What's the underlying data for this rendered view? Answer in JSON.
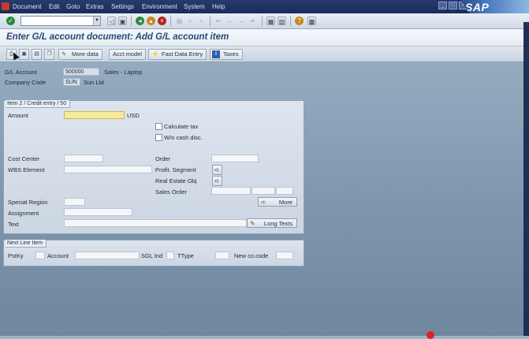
{
  "menu": [
    "Document",
    "Edit",
    "Goto",
    "Extras",
    "Settings",
    "Environment",
    "System",
    "Help"
  ],
  "brand": "SAP",
  "title": "Enter G/L account document: Add G/L account item",
  "app_toolbar": {
    "more_data": "More data",
    "acct_model": "Acct model",
    "fast_data_entry": "Fast Data Entry",
    "taxes": "Taxes"
  },
  "header": {
    "gl_account_label": "G/L Account",
    "gl_account_value": "500000",
    "gl_account_desc": "Sales - Laptop",
    "company_code_label": "Company Code",
    "company_code_value": "SUN",
    "company_code_desc": "Sun Ltd"
  },
  "item_group": {
    "title": "Item 2 / Credit entry / 50",
    "amount_label": "Amount",
    "amount_value": "",
    "currency": "USD",
    "calculate_tax": "Calculate tax",
    "wo_cash_disc": "W/o cash disc.",
    "cost_center": "Cost Center",
    "order": "Order",
    "wbs_element": "WBS Element",
    "profit_segment": "Profit. Segment",
    "real_estate_obj": "Real Estate Obj",
    "sales_order": "Sales Order",
    "special_region": "Special Region",
    "more": "More",
    "assignment": "Assignment",
    "text": "Text",
    "long_texts": "Long Texts"
  },
  "next_line": {
    "title": "Next Line Item",
    "pstky": "PstKy",
    "account": "Account",
    "sgl_ind": "SGL Ind",
    "ttype": "TType",
    "new_co_code": "New co.code"
  },
  "colors": {
    "menubar": "#1a2c5a",
    "title_text": "#2a4a75",
    "required_field": "#f6ea9a",
    "background": "#8aa1b7"
  },
  "icons": [
    "enter-icon",
    "save-icon",
    "back-icon",
    "exit-icon",
    "cancel-icon",
    "print-icon",
    "find-icon",
    "first-page-icon",
    "prev-page-icon",
    "next-page-icon",
    "last-page-icon",
    "create-session-icon",
    "shortcut-icon",
    "help-icon",
    "layout-icon"
  ]
}
